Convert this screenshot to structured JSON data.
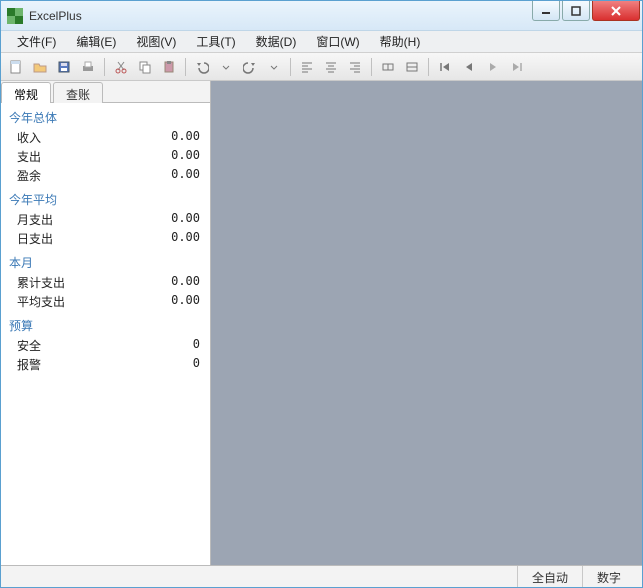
{
  "window": {
    "title": "ExcelPlus"
  },
  "menus": {
    "file": "文件(F)",
    "edit": "编辑(E)",
    "view": "视图(V)",
    "tools": "工具(T)",
    "data": "数据(D)",
    "window": "窗口(W)",
    "help": "帮助(H)"
  },
  "tabs": {
    "general": "常规",
    "ledger": "查账"
  },
  "sections": {
    "year_total": {
      "header": "今年总体",
      "income": "收入",
      "expense": "支出",
      "surplus": "盈余",
      "income_v": "0.00",
      "expense_v": "0.00",
      "surplus_v": "0.00"
    },
    "year_avg": {
      "header": "今年平均",
      "month_exp": "月支出",
      "day_exp": "日支出",
      "month_exp_v": "0.00",
      "day_exp_v": "0.00"
    },
    "this_month": {
      "header": "本月",
      "cum_exp": "累计支出",
      "avg_exp": "平均支出",
      "cum_exp_v": "0.00",
      "avg_exp_v": "0.00"
    },
    "budget": {
      "header": "预算",
      "safe": "安全",
      "alert": "报警",
      "safe_v": "0",
      "alert_v": "0"
    }
  },
  "status": {
    "auto": "全自动",
    "number": "数字"
  }
}
